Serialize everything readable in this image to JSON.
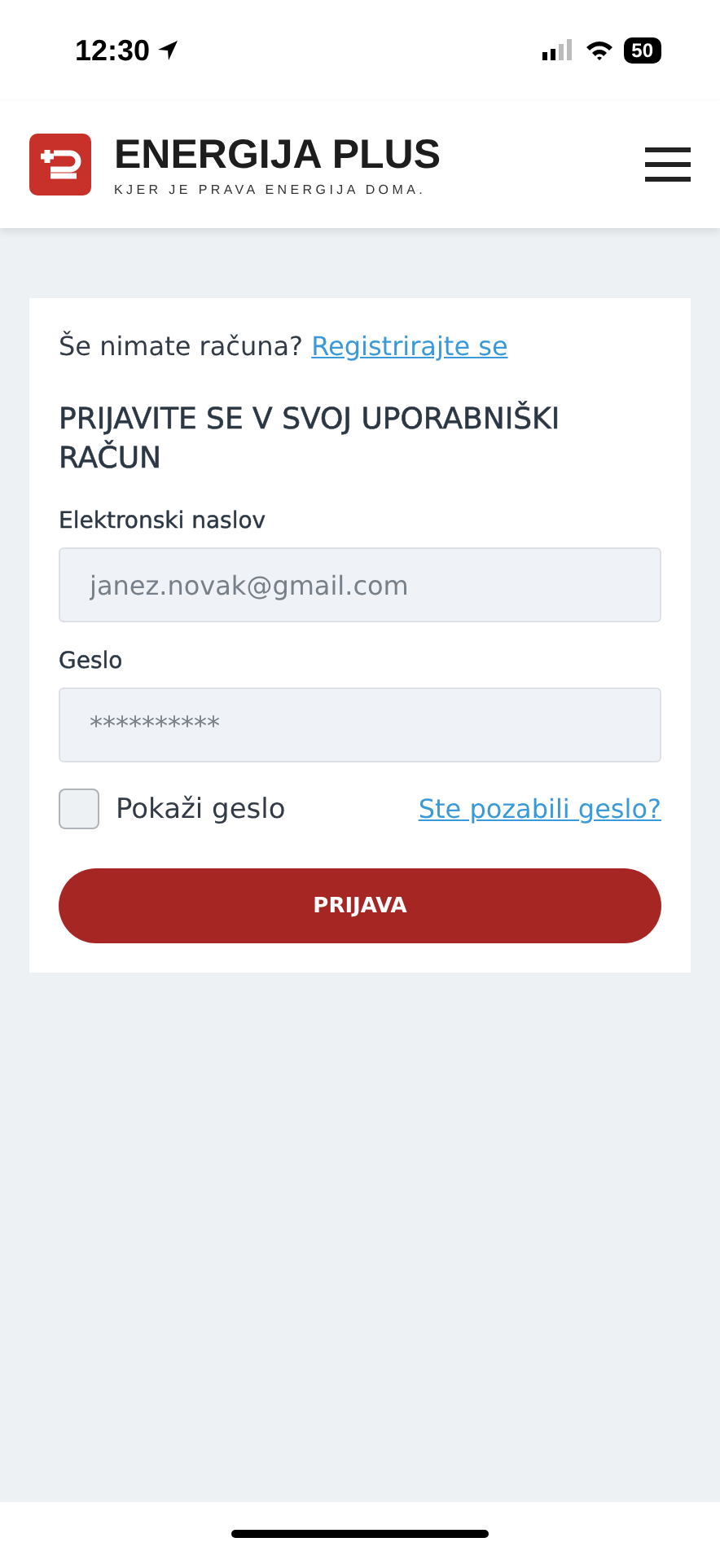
{
  "status_bar": {
    "time": "12:30",
    "battery": "50"
  },
  "header": {
    "brand": "ENERGIJA PLUS",
    "tagline": "KJER JE PRAVA ENERGIJA DOMA."
  },
  "login": {
    "prompt": "Še nimate računa?",
    "register_link": "Registrirajte se",
    "title": "PRIJAVITE SE V SVOJ UPORABNIŠKI RAČUN",
    "fields": [
      {
        "label": "Elektronski naslov",
        "placeholder": "janez.novak@gmail.com"
      },
      {
        "label": "Geslo",
        "placeholder": "**********"
      }
    ],
    "show_password": {
      "label": "Pokaži geslo",
      "checked": false
    },
    "forgot_link": "Ste pozabili geslo?",
    "submit": "PRIJAVA"
  }
}
